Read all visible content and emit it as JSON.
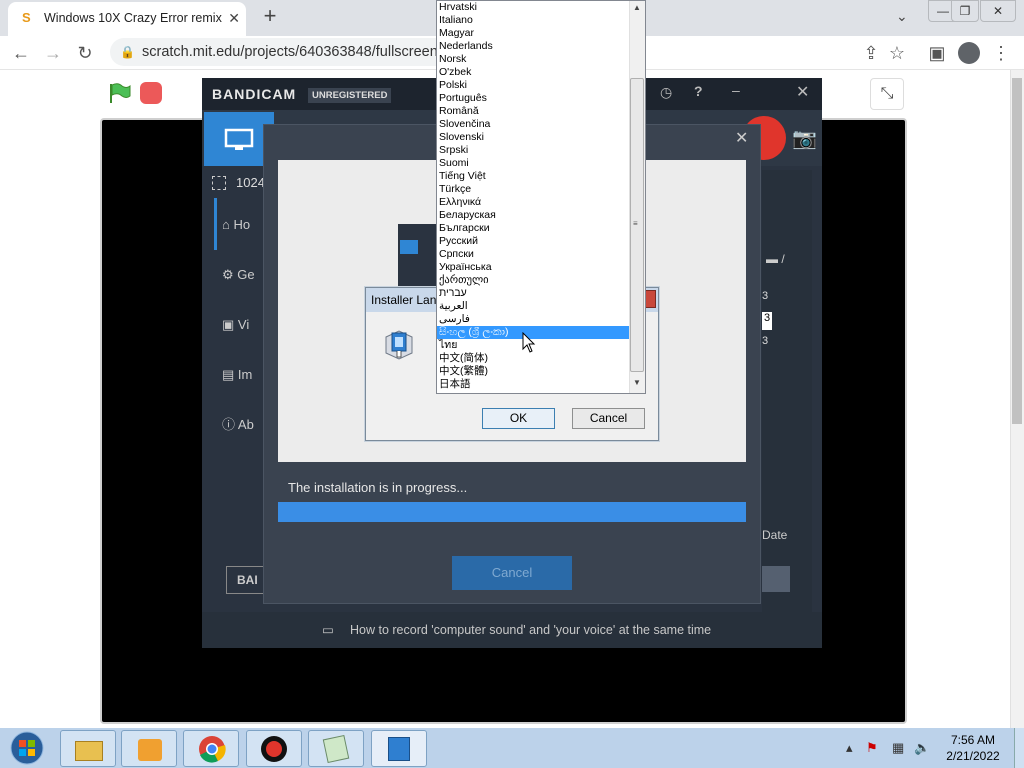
{
  "browser": {
    "tab_title": "Windows 10X Crazy Error remix",
    "url": "scratch.mit.edu/projects/640363848/fullscreen/",
    "window_controls": {
      "minimize": "⌄",
      "restore": "—",
      "maximize": "❐",
      "close": "✕"
    }
  },
  "bandicam": {
    "logo": "BANDICAM",
    "badge": "UNREGISTERED",
    "resolution_label": "1024",
    "sidebar": [
      "Ho",
      "Ge",
      "Vi",
      "Im",
      "Ab"
    ],
    "right_col": [
      "/",
      "3",
      "3",
      "3",
      "Date"
    ],
    "banner_label": "BAI",
    "footer_text": "How to record 'computer sound' and 'your voice' at the same time"
  },
  "installer": {
    "status_text": "The installation is in progress...",
    "progress": 1.0,
    "cancel_label": "Cancel"
  },
  "dialog": {
    "title": "Installer Lan",
    "ok_label": "OK",
    "cancel_label": "Cancel"
  },
  "dropdown": {
    "items": [
      "Hrvatski",
      "Italiano",
      "Magyar",
      "Nederlands",
      "Norsk",
      "O'zbek",
      "Polski",
      "Português",
      "Română",
      "Slovenčina",
      "Slovenski",
      "Srpski",
      "Suomi",
      "Tiếng Việt",
      "Türkçe",
      "Ελληνικά",
      "Беларуская",
      "Български",
      "Русский",
      "Српски",
      "Українська",
      "ქართული",
      "עברית",
      "العربية",
      "فارسی",
      "සිංහල (ශ්‍රී ලංකා)",
      "ไทย",
      "中文(简体)",
      "中文(繁體)",
      "日本語"
    ],
    "selected_index": 25
  },
  "taskbar": {
    "time": "7:56 AM",
    "date": "2/21/2022"
  },
  "colors": {
    "accent": "#3399ff",
    "bandicam_bg": "#2a3340",
    "progress": "#3a8ee6",
    "record": "#e0352c"
  }
}
